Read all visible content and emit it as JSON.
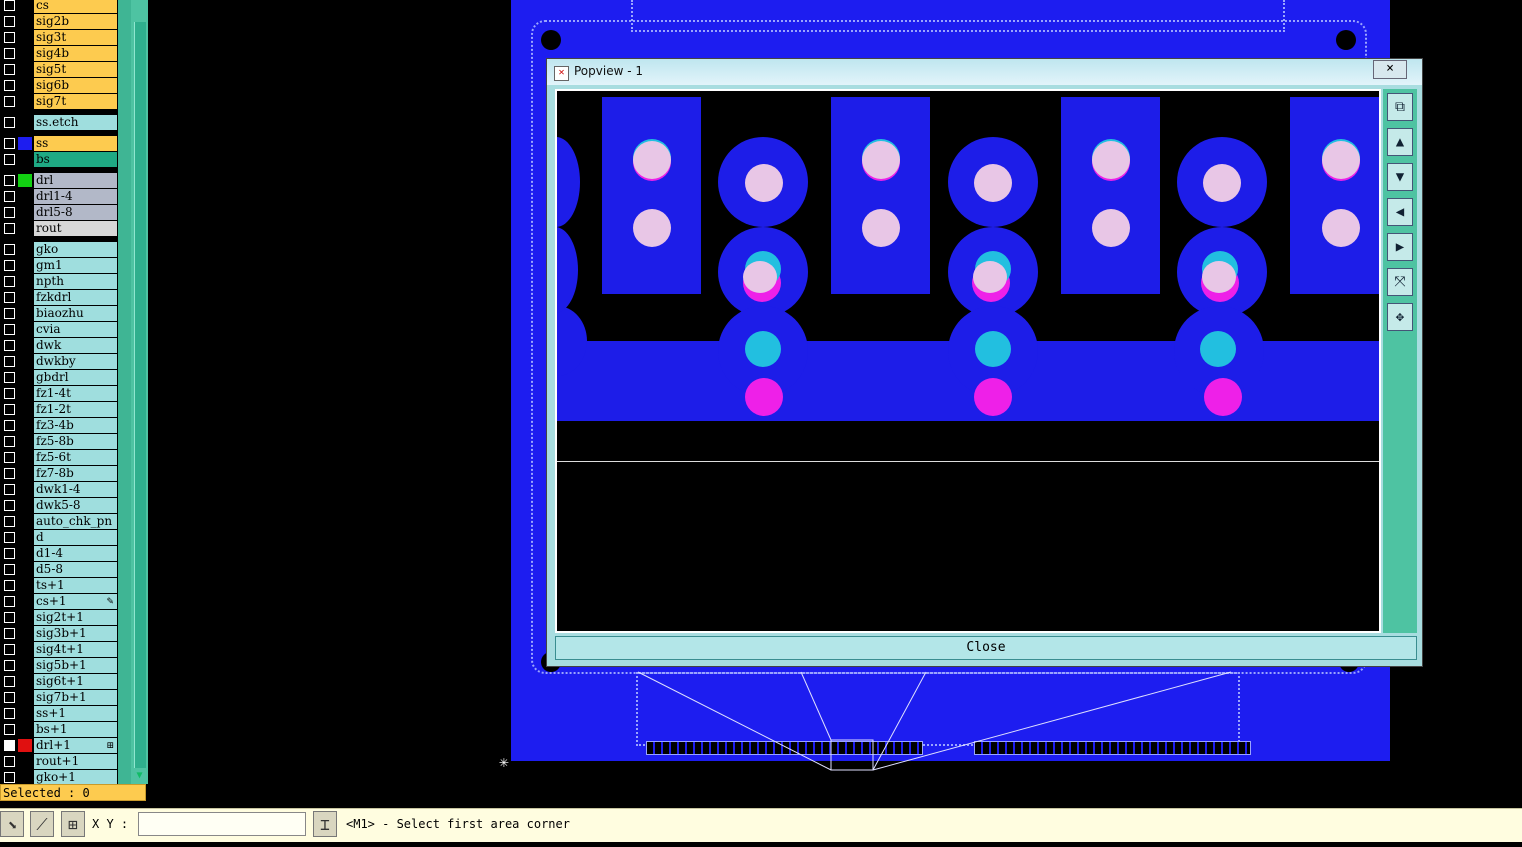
{
  "layers": [
    {
      "name": "cs",
      "color": "#fdcb4f"
    },
    {
      "name": "sig2b",
      "color": "#fdcb4f"
    },
    {
      "name": "sig3t",
      "color": "#fdcb4f"
    },
    {
      "name": "sig4b",
      "color": "#fdcb4f"
    },
    {
      "name": "sig5t",
      "color": "#fdcb4f"
    },
    {
      "name": "sig6b",
      "color": "#fdcb4f"
    },
    {
      "name": "sig7t",
      "color": "#fdcb4f"
    },
    {
      "name": "ss.etch",
      "color": "#9fdede"
    },
    {
      "name": "ss",
      "color": "#fdcb4f",
      "swatch": "#1d1df0"
    },
    {
      "name": "bs",
      "color": "#1faa84"
    },
    {
      "name": "drl",
      "color": "#b2b8c8",
      "swatch": "#12d012"
    },
    {
      "name": "drl1-4",
      "color": "#b2b8c8"
    },
    {
      "name": "drl5-8",
      "color": "#b2b8c8"
    },
    {
      "name": "rout",
      "color": "#d8d8d8"
    },
    {
      "name": "gko",
      "color": "#9fdede"
    },
    {
      "name": "gm1",
      "color": "#9fdede"
    },
    {
      "name": "npth",
      "color": "#9fdede"
    },
    {
      "name": "fzkdrl",
      "color": "#9fdede"
    },
    {
      "name": "biaozhu",
      "color": "#9fdede"
    },
    {
      "name": "cvia",
      "color": "#9fdede"
    },
    {
      "name": "dwk",
      "color": "#9fdede"
    },
    {
      "name": "dwkby",
      "color": "#9fdede"
    },
    {
      "name": "gbdrl",
      "color": "#9fdede"
    },
    {
      "name": "fz1-4t",
      "color": "#9fdede"
    },
    {
      "name": "fz1-2t",
      "color": "#9fdede"
    },
    {
      "name": "fz3-4b",
      "color": "#9fdede"
    },
    {
      "name": "fz5-8b",
      "color": "#9fdede"
    },
    {
      "name": "fz5-6t",
      "color": "#9fdede"
    },
    {
      "name": "fz7-8b",
      "color": "#9fdede"
    },
    {
      "name": "dwk1-4",
      "color": "#9fdede"
    },
    {
      "name": "dwk5-8",
      "color": "#9fdede"
    },
    {
      "name": "auto_chk_pn",
      "color": "#9fdede"
    },
    {
      "name": "d",
      "color": "#9fdede"
    },
    {
      "name": "d1-4",
      "color": "#9fdede"
    },
    {
      "name": "d5-8",
      "color": "#9fdede"
    },
    {
      "name": "ts+1",
      "color": "#9fdede"
    },
    {
      "name": "cs+1",
      "color": "#9fdede",
      "flag": "✎"
    },
    {
      "name": "sig2t+1",
      "color": "#9fdede"
    },
    {
      "name": "sig3b+1",
      "color": "#9fdede"
    },
    {
      "name": "sig4t+1",
      "color": "#9fdede"
    },
    {
      "name": "sig5b+1",
      "color": "#9fdede"
    },
    {
      "name": "sig6t+1",
      "color": "#9fdede"
    },
    {
      "name": "sig7b+1",
      "color": "#9fdede"
    },
    {
      "name": "ss+1",
      "color": "#9fdede"
    },
    {
      "name": "bs+1",
      "color": "#9fdede"
    },
    {
      "name": "drl+1",
      "color": "#9fdede",
      "swatch": "#e01010",
      "checked": true,
      "flag": "⊞"
    },
    {
      "name": "rout+1",
      "color": "#9fdede"
    },
    {
      "name": "gko+1",
      "color": "#9fdede"
    }
  ],
  "selected_label": "Selected : 0",
  "xy_label": "X Y :",
  "xy_value": "",
  "status_message": "<M1> - Select first area corner",
  "popview": {
    "title": "Popview - 1",
    "close_x": "×",
    "close_button": "Close"
  },
  "colors": {
    "board_blue": "#1d1df0",
    "pad_pink": "#e8c6e6",
    "via_cyan": "#22bfe0",
    "via_magenta": "#ee20e8",
    "panel_teal": "#4ec3a2"
  },
  "icons": [
    "area-select-icon",
    "line-select-icon",
    "grid-icon",
    "cursor-icon",
    "window-icon",
    "up-icon",
    "down-icon",
    "left-icon",
    "right-icon",
    "fit-icon",
    "pan-icon"
  ]
}
